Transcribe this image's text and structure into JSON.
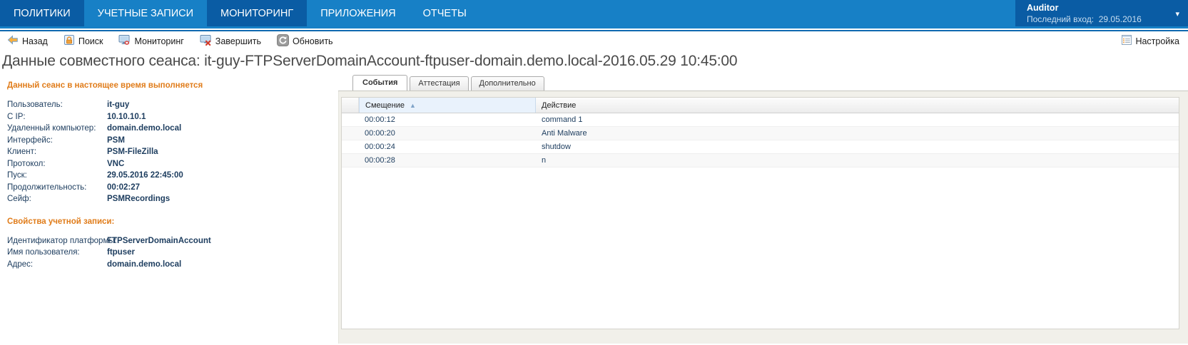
{
  "nav": {
    "items": [
      {
        "label": "ПОЛИТИКИ"
      },
      {
        "label": "УЧЕТНЫЕ ЗАПИСИ"
      },
      {
        "label": "МОНИТОРИНГ"
      },
      {
        "label": "ПРИЛОЖЕНИЯ"
      },
      {
        "label": "ОТЧЕТЫ"
      }
    ],
    "user": {
      "name": "Auditor",
      "last_login_label": "Последний вход:",
      "last_login_value": "29.05.2016"
    }
  },
  "toolbar": {
    "buttons": [
      {
        "label": "Назад",
        "icon": "back-icon"
      },
      {
        "label": "Поиск",
        "icon": "search-icon"
      },
      {
        "label": "Мониторинг",
        "icon": "monitoring-icon"
      },
      {
        "label": "Завершить",
        "icon": "terminate-icon"
      },
      {
        "label": "Обновить",
        "icon": "refresh-icon"
      }
    ],
    "settings": {
      "label": "Настройка",
      "icon": "settings-icon"
    }
  },
  "page_title": "Данные совместного сеанса: it-guy-FTPServerDomainAccount-ftpuser-domain.demo.local-2016.05.29 10:45:00",
  "session_panel": {
    "status_header": "Данный сеанс в настоящее время выполняется",
    "fields": [
      {
        "label": "Пользователь:",
        "value": "it-guy"
      },
      {
        "label": "С IP:",
        "value": "10.10.10.1"
      },
      {
        "label": "Удаленный компьютер:",
        "value": "domain.demo.local"
      },
      {
        "label": "Интерфейс:",
        "value": "PSM"
      },
      {
        "label": "Клиент:",
        "value": "PSM-FileZilla"
      },
      {
        "label": "Протокол:",
        "value": "VNC"
      },
      {
        "label": "Пуск:",
        "value": "29.05.2016 22:45:00"
      },
      {
        "label": "Продолжительность:",
        "value": "00:02:27"
      },
      {
        "label": "Сейф:",
        "value": "PSMRecordings"
      }
    ],
    "account_header": "Свойства учетной записи:",
    "account_fields": [
      {
        "label": "Идентификатор платформы:",
        "value": "FTPServerDomainAccount"
      },
      {
        "label": "Имя пользователя:",
        "value": "ftpuser"
      },
      {
        "label": "Адрес:",
        "value": "domain.demo.local"
      }
    ]
  },
  "events_panel": {
    "tabs": [
      {
        "label": "События",
        "active": true
      },
      {
        "label": "Аттестация",
        "active": false
      },
      {
        "label": "Дополнительно",
        "active": false
      }
    ],
    "table": {
      "columns": [
        "Смещение",
        "Действие"
      ],
      "sort": {
        "column": "Смещение",
        "direction": "asc"
      },
      "rows": [
        [
          "00:00:12",
          "command 1"
        ],
        [
          "00:00:20",
          "Anti Malware"
        ],
        [
          "00:00:24",
          "shutdow"
        ],
        [
          "00:00:28",
          "n"
        ]
      ]
    }
  },
  "colors": {
    "nav_blue": "#1780C6",
    "nav_dark_blue": "#0A5CA4",
    "accent_orange": "#E07C1A",
    "navy_text": "#1C3C5E",
    "sorted_column_bg": "#E9F2FC",
    "panel_beige": "#F1F0EA"
  }
}
